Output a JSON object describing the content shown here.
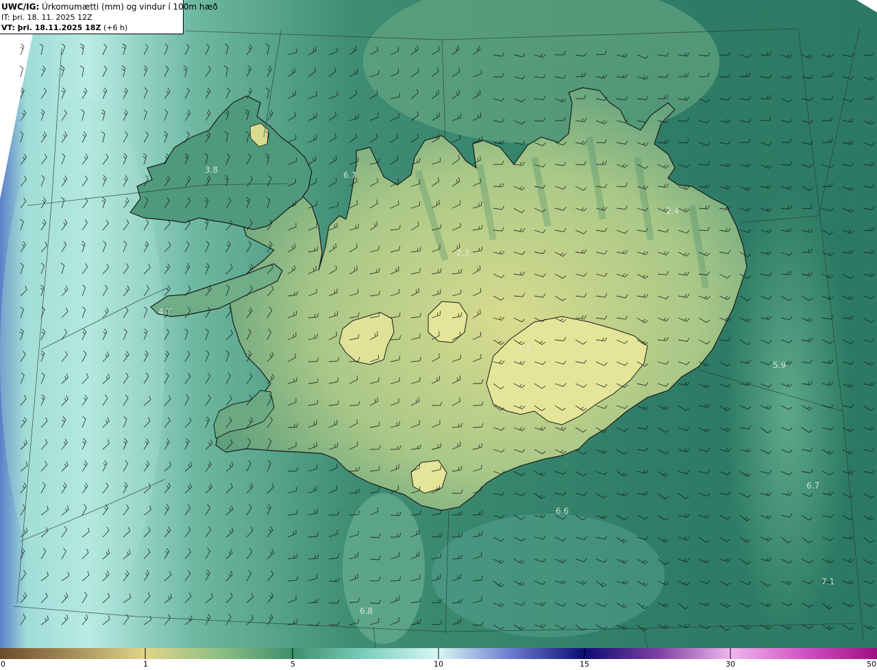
{
  "header": {
    "title_code": "UWC/IG:",
    "title_text": "Úrkomumætti (mm) og vindur í 100m hæð",
    "init_time": "IT: þri. 18. 11. 2025 12Z",
    "valid_time_label": "VT: þri. 18.11.2025 18Z",
    "valid_time_offset": "(+6 h)"
  },
  "map_values": [
    {
      "name": "value-3-8",
      "text": "3.8"
    },
    {
      "name": "value-6-7-north",
      "text": "6.7"
    },
    {
      "name": "value-2-4",
      "text": "2.4"
    },
    {
      "name": "value-2-3",
      "text": "2.3"
    },
    {
      "name": "value-4-7",
      "text": "4.7"
    },
    {
      "name": "value-1-2",
      "text": "1.2"
    },
    {
      "name": "value-5-9",
      "text": "5.9"
    },
    {
      "name": "value-6-7-east",
      "text": "6.7"
    },
    {
      "name": "value-6-6",
      "text": "6.6"
    },
    {
      "name": "value-7-1",
      "text": "7.1"
    },
    {
      "name": "value-6-8",
      "text": "6.8"
    }
  ],
  "colorbar": {
    "ticks": [
      "0",
      "1",
      "5",
      "10",
      "15",
      "30",
      "50"
    ],
    "colors": [
      "#6b4a2a",
      "#d9cf84",
      "#3f8f6c",
      "#c8f4ef",
      "#1f1f8c",
      "#e9a9e9",
      "#b0128a"
    ]
  },
  "colors": {
    "sea_base": "#3d8b72",
    "land_dry": "#cfd88a",
    "glacier": "#e8e89a",
    "coastline": "#1a1a1a",
    "grid": "#2a3a32"
  }
}
